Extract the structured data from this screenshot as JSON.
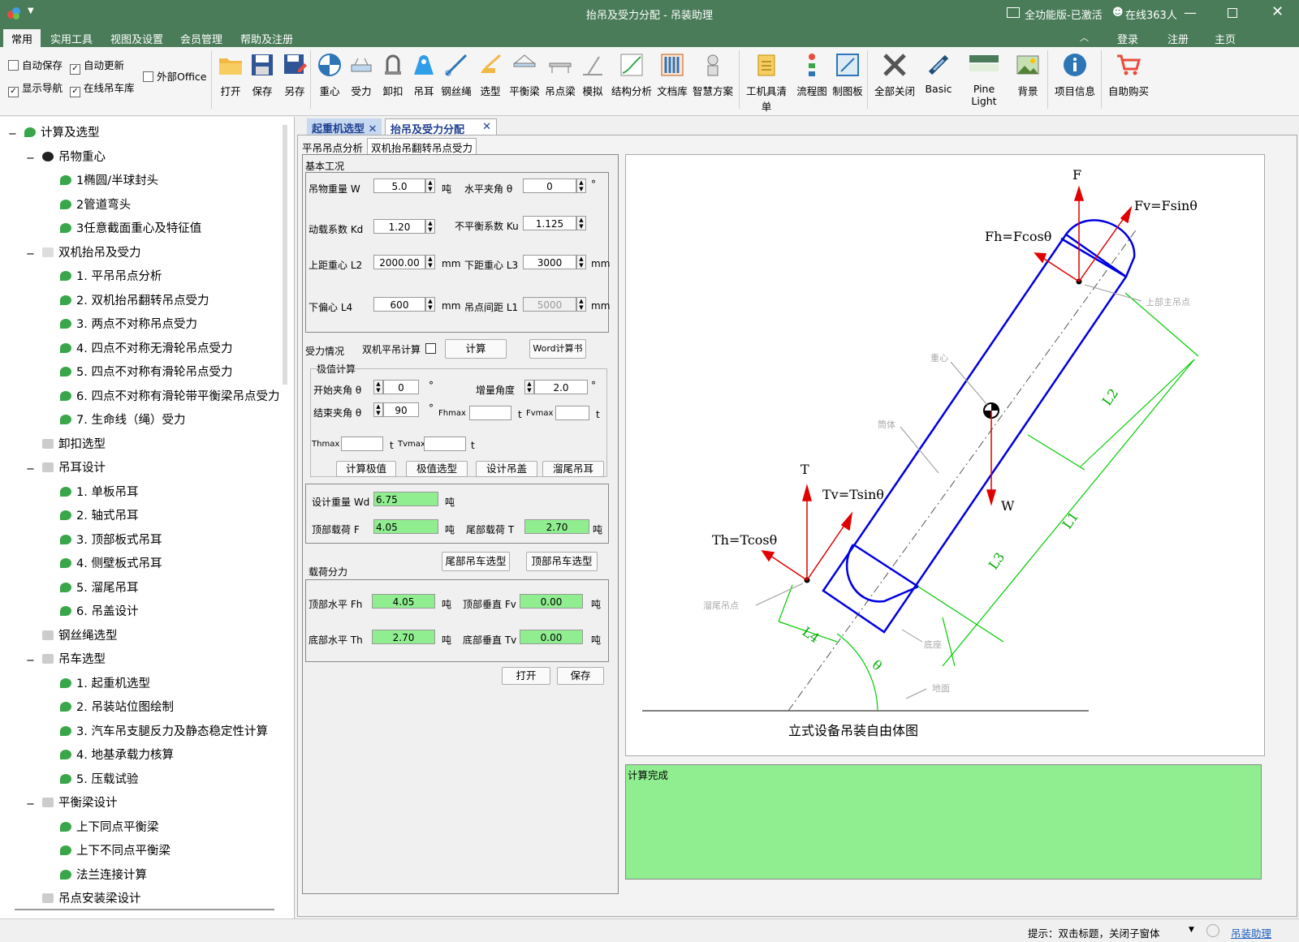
{
  "window": {
    "title": "抬吊及受力分配 - 吊装助理",
    "edition": "全功能版-已激活",
    "online": "在线363人"
  },
  "menu": {
    "items": [
      "常用",
      "实用工具",
      "视图及设置",
      "会员管理",
      "帮助及注册"
    ],
    "right": [
      "登录",
      "注册",
      "主页"
    ]
  },
  "ribbon": {
    "checks": [
      {
        "label": "自动保存",
        "checked": false
      },
      {
        "label": "自动更新",
        "checked": true
      },
      {
        "label": "外部Office",
        "checked": false
      },
      {
        "label": "显示导航",
        "checked": true
      },
      {
        "label": "在线吊车库",
        "checked": true
      }
    ],
    "buttons": [
      "打开",
      "保存",
      "另存",
      "重心",
      "受力",
      "卸扣",
      "吊耳",
      "钢丝绳",
      "选型",
      "平衡梁",
      "吊点梁",
      "模拟",
      "结构分析",
      "文档库",
      "智慧方案",
      "工机具清单",
      "流程图",
      "制图板",
      "全部关闭",
      "Basic",
      "Pine Light",
      "背景",
      "项目信息",
      "自助购买"
    ]
  },
  "tree": [
    "计算及选型",
    "吊物重心",
    "1椭圆/半球封头",
    "2管道弯头",
    "3任意截面重心及特征值",
    "双机抬吊及受力",
    "1. 平吊吊点分析",
    "2. 双机抬吊翻转吊点受力",
    "3. 两点不对称吊点受力",
    "4. 四点不对称无滑轮吊点受力",
    "5. 四点不对称有滑轮吊点受力",
    "6. 四点不对称有滑轮带平衡梁吊点受力",
    "7. 生命线（绳）受力",
    "卸扣选型",
    "吊耳设计",
    "1. 单板吊耳",
    "2. 轴式吊耳",
    "3. 顶部板式吊耳",
    "4. 侧壁板式吊耳",
    "5. 溜尾吊耳",
    "6. 吊盖设计",
    "钢丝绳选型",
    "吊车选型",
    "1. 起重机选型",
    "2. 吊装站位图绘制",
    "3. 汽车吊支腿反力及静态稳定性计算",
    "4. 地基承载力核算",
    "5. 压载试验",
    "平衡梁设计",
    "上下同点平衡梁",
    "上下不同点平衡梁",
    "法兰连接计算",
    "吊点安装梁设计"
  ],
  "doc_tabs": [
    "起重机选型",
    "抬吊及受力分配"
  ],
  "sub_tabs": [
    "平吊吊点分析",
    "双机抬吊翻转吊点受力"
  ],
  "form": {
    "base_title": "基本工况",
    "W_label": "吊物重量 W",
    "W": "5.0",
    "unit_t": "吨",
    "theta_label": "水平夹角 θ",
    "theta": "0",
    "deg": "°",
    "Kd_label": "动载系数 Kd",
    "Kd": "1.20",
    "Ku_label": "不平衡系数 Ku",
    "Ku": "1.125",
    "L2_label": "上距重心 L2",
    "L2": "2000.00",
    "mm": "mm",
    "L3_label": "下距重心 L3",
    "L3": "3000",
    "L4_label": "下偏心 L4",
    "L4": "600",
    "L1_label": "吊点间距 L1",
    "L1": "5000",
    "force_title": "受力情况",
    "dual_label": "双机平吊计算",
    "calc_btn": "计算",
    "word_btn": "Word计算书",
    "ext_title": "极值计算",
    "start_label": "开始夹角 θ",
    "start": "0",
    "inc_label": "增量角度",
    "inc": "2.0",
    "end_label": "结束夹角 θ",
    "end": "90",
    "fhmax_label": "Fhmax",
    "fvmax_label": "Fvmax",
    "t": "t",
    "thmax_label": "Thmax",
    "tvmax_label": "Tvmax",
    "btn_ext": "计算极值",
    "btn_extsel": "极值选型",
    "btn_cover": "设计吊盖",
    "btn_tail": "溜尾吊耳",
    "Wd_label": "设计重量 Wd",
    "Wd": "6.75",
    "F_label": "顶部载荷 F",
    "F": "4.05",
    "T_label": "尾部载荷 T",
    "T": "2.70",
    "split_title": "载荷分力",
    "btn_tail_crane": "尾部吊车选型",
    "btn_top_crane": "顶部吊车选型",
    "Fh_label": "顶部水平 Fh",
    "Fh": "4.05",
    "Fv_label": "顶部垂直 Fv",
    "Fv": "0.00",
    "Th_label": "底部水平 Th",
    "Th": "2.70",
    "Tv_label": "底部垂直 Tv",
    "Tv": "0.00",
    "open_btn": "打开",
    "save_btn": "保存"
  },
  "diagram": {
    "F": "F",
    "Fv": "Fv=Fsinθ",
    "Fh": "Fh=Fcosθ",
    "top_point": "上部主吊点",
    "cg": "重心",
    "body": "筒体",
    "L2": "L2",
    "L1": "L1",
    "L3": "L3",
    "L4": "L4",
    "T": "T",
    "Tv": "Tv=Tsinθ",
    "Th": "Th=Tcosθ",
    "W": "W",
    "tail_point": "溜尾吊点",
    "base": "底座",
    "ground": "地面",
    "theta": "θ",
    "caption": "立式设备吊装自由体图"
  },
  "result_text": "计算完成",
  "status": {
    "hint": "提示：双击标题，关闭子窗体",
    "link": "吊装助理"
  },
  "colors": {
    "title": "#4a7c59",
    "green": "#90ee90",
    "blue": "#0000e0",
    "red": "#e00000",
    "line": "#00cc00"
  }
}
